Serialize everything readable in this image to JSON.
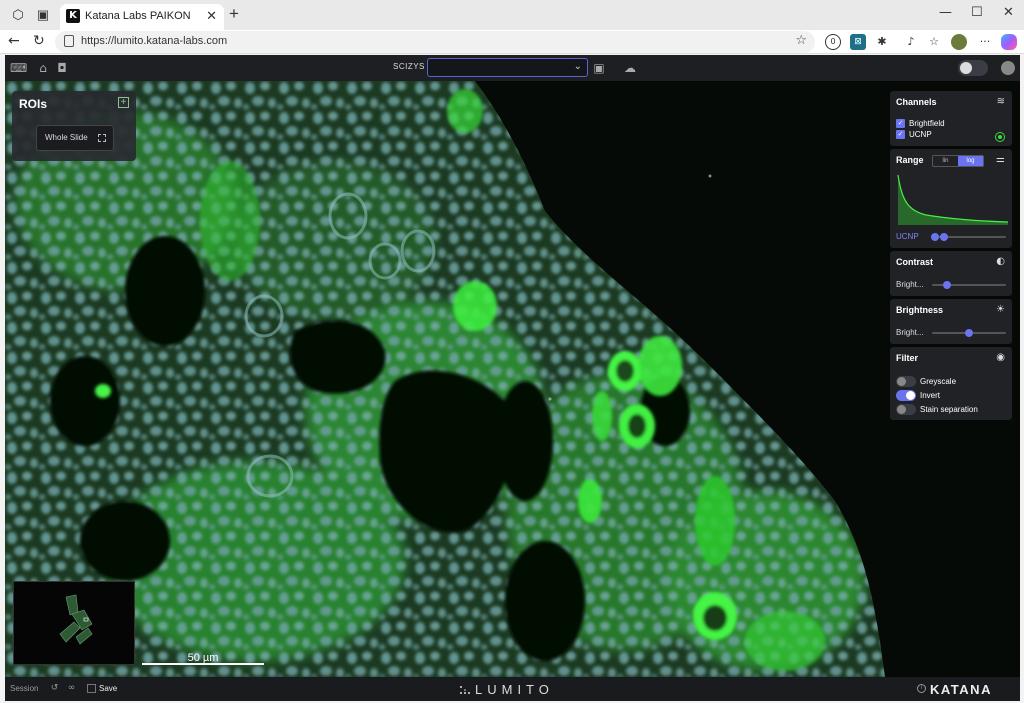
{
  "browser": {
    "tab_title": "Katana Labs PAIKON",
    "tab_close": "✕",
    "new_tab": "+",
    "url": "https://lumito.katana-labs.com",
    "minimize": "—",
    "maximize": "☐",
    "close": "✕"
  },
  "toolbar": {
    "slide_label": "SCIZYS",
    "slide_select_value": ""
  },
  "rois": {
    "title": "ROIs",
    "add": "+",
    "whole_slide": "Whole Slide"
  },
  "channels": {
    "title": "Channels",
    "items": [
      {
        "label": "Brightfield",
        "checked": true
      },
      {
        "label": "UCNP",
        "checked": true
      }
    ],
    "ucnp_color": "#3ae03a"
  },
  "range": {
    "title": "Range",
    "lin": "lin",
    "log": "log",
    "active_scale": "log",
    "channel_label": "UCNP"
  },
  "contrast": {
    "title": "Contrast",
    "slider_label": "Bright...",
    "value": 0.2
  },
  "brightness": {
    "title": "Brightness",
    "slider_label": "Bright...",
    "value": 0.5
  },
  "filter": {
    "title": "Filter",
    "items": [
      {
        "label": "Greyscale",
        "on": false
      },
      {
        "label": "Invert",
        "on": true
      },
      {
        "label": "Stain separation",
        "on": false
      }
    ]
  },
  "scalebar": {
    "label": "50 µm"
  },
  "footer": {
    "session": "Session",
    "save": "Save",
    "lumito": "LUMITO",
    "katana": "KATANA"
  },
  "colors": {
    "accent": "#6b74f0",
    "fluorescent": "#3ae03a"
  }
}
